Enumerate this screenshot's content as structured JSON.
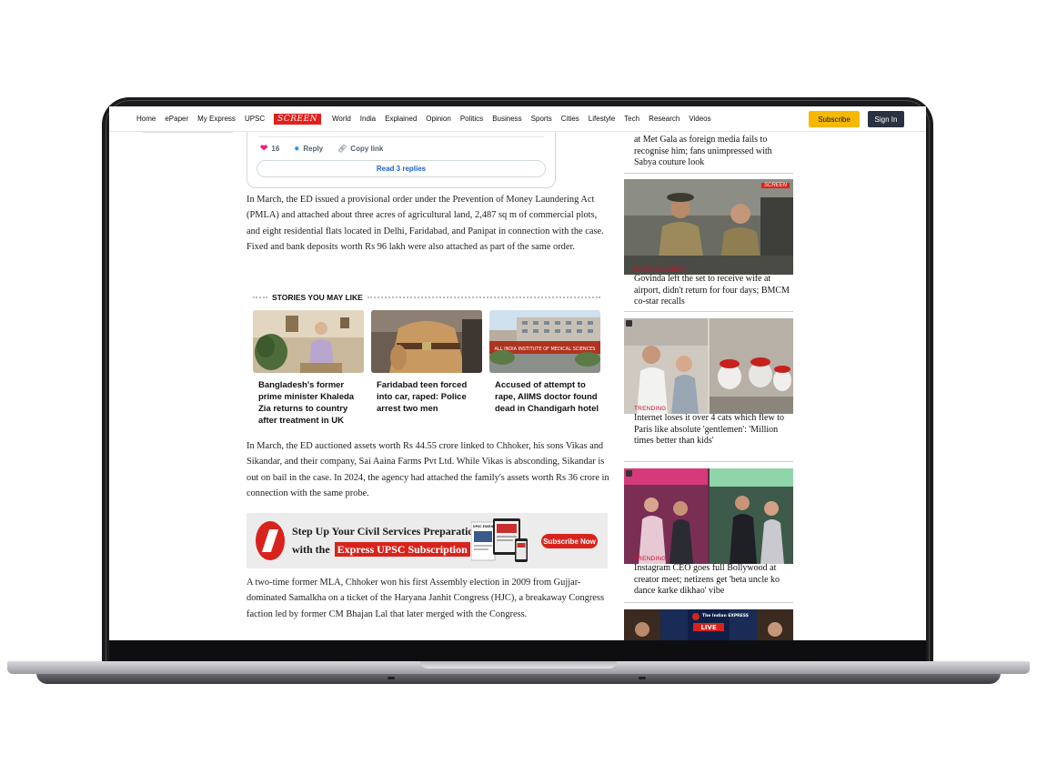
{
  "nav": {
    "items": [
      "Home",
      "ePaper",
      "My Express",
      "UPSC",
      "SCREEN",
      "World",
      "India",
      "Explained",
      "Opinion",
      "Politics",
      "Business",
      "Sports",
      "Cities",
      "Lifestyle",
      "Tech",
      "Research",
      "Videos"
    ],
    "subscribe": "Subscribe",
    "signin": "Sign In"
  },
  "tweet": {
    "likes": "16",
    "reply": "Reply",
    "copy": "Copy link",
    "read_replies": "Read 3 replies"
  },
  "article": {
    "p1": "In March, the ED issued a provisional order under the Prevention of Money Laundering Act (PMLA) and attached about three acres of agricultural land, 2,487 sq m of commercial plots, and eight residential flats located in Delhi, Faridabad, and Panipat in connection with the case. Fixed and bank deposits worth Rs 96 lakh were also attached as part of the same order.",
    "p2": "In March, the ED auctioned assets worth Rs 44.55 crore linked to Chhoker, his sons Vikas and Sikandar, and their company, Sai Aaina Farms Pvt Ltd. While Vikas is absconding, Sikandar is out on bail in the case. In 2024, the agency had attached the family's assets worth Rs 36 crore in connection with the same probe.",
    "p3": "A two-time former MLA, Chhoker won his first Assembly election in 2009 from Gujjar-dominated Samalkha on a ticket of the Haryana Janhit Congress (HJC), a breakaway Congress faction led by former CM Bhajan Lal that later merged with the Congress."
  },
  "stories": {
    "title": "STORIES YOU MAY LIKE",
    "items": [
      {
        "caption": "Bangladesh's former prime minister Khaleda Zia returns to country after treatment in UK"
      },
      {
        "caption": "Faridabad teen forced into car, raped: Police arrest two men"
      },
      {
        "caption": "Accused of attempt to rape, AIIMS doctor found dead in Chandigarh hotel"
      }
    ]
  },
  "ad": {
    "line1": "Step Up Your Civil Services Preparation",
    "line2_pre": "with the",
    "line2_hl": "Express UPSC Subscription",
    "cta": "Subscribe Now",
    "mag_title": "UPSC ESSENTIALS",
    "aiims_sign": "ALL INDIA INSTITUTE OF MEDICAL SCIENCES"
  },
  "sidebar": {
    "top_text": "at Met Gala as foreign media fails to recognise him; fans unimpressed with Sabya couture look",
    "items": [
      {
        "tag": "ENTERTAINMENT",
        "title": "Govinda left the set to receive wife at airport, didn't return for four days; BMCM co-star recalls",
        "badge": "SCREEN"
      },
      {
        "tag": "TRENDING",
        "title": "Internet loses it over 4 cats which flew to Paris like absolute 'gentlemen': 'Million times better than kids'"
      },
      {
        "tag": "TRENDING",
        "title": "Instagram CEO goes full Bollywood at creator meet; netizens get 'beta uncle ko dance karke dikhao' vibe"
      }
    ],
    "live_logo": "The Indian EXPRESS",
    "live_label": "LIVE"
  }
}
